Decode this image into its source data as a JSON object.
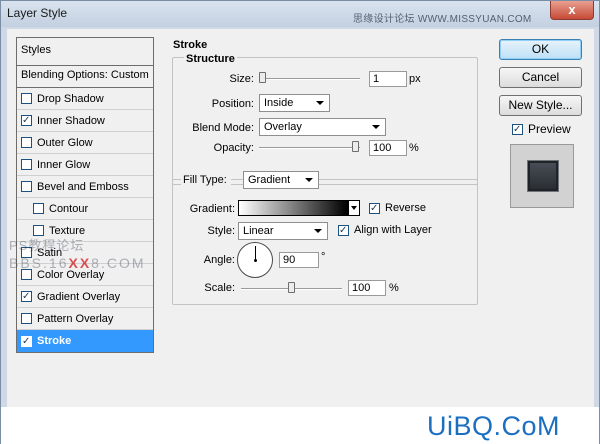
{
  "window": {
    "title": "Layer Style",
    "watermark_top": "思缘设计论坛 WWW.MISSYUAN.COM",
    "close_label": "x"
  },
  "sidebar": {
    "header": "Styles",
    "blending_options": "Blending Options: Custom",
    "items": [
      {
        "label": "Drop Shadow",
        "checked": false
      },
      {
        "label": "Inner Shadow",
        "checked": true
      },
      {
        "label": "Outer Glow",
        "checked": false
      },
      {
        "label": "Inner Glow",
        "checked": false
      },
      {
        "label": "Bevel and Emboss",
        "checked": false
      },
      {
        "label": "Contour",
        "checked": false
      },
      {
        "label": "Texture",
        "checked": false
      },
      {
        "label": "Satin",
        "checked": false
      },
      {
        "label": "Color Overlay",
        "checked": false
      },
      {
        "label": "Gradient Overlay",
        "checked": true
      },
      {
        "label": "Pattern Overlay",
        "checked": false
      },
      {
        "label": "Stroke",
        "checked": true,
        "selected": true
      }
    ],
    "watermark_line1": "PS教程论坛",
    "watermark_line2a": "BBS.16",
    "watermark_xx": "XX",
    "watermark_line2b": "8.COM"
  },
  "stroke": {
    "title": "Stroke",
    "structure_title": "Structure",
    "size_label": "Size:",
    "size_value": "1",
    "size_unit": "px",
    "size_level": 0.0,
    "position_label": "Position:",
    "position_value": "Inside",
    "blend_mode_label": "Blend Mode:",
    "blend_mode_value": "Overlay",
    "opacity_label": "Opacity:",
    "opacity_value": "100",
    "opacity_unit": "%",
    "opacity_level": 1.0
  },
  "fill": {
    "fill_type_label": "Fill Type:",
    "fill_type_value": "Gradient",
    "gradient_label": "Gradient:",
    "reverse_label": "Reverse",
    "reverse_checked": true,
    "style_label": "Style:",
    "style_value": "Linear",
    "align_label": "Align with Layer",
    "align_checked": true,
    "angle_label": "Angle:",
    "angle_value": "90",
    "angle_unit": "°",
    "scale_label": "Scale:",
    "scale_value": "100",
    "scale_unit": "%",
    "scale_level": 0.5
  },
  "buttons": {
    "ok": "OK",
    "cancel": "Cancel",
    "new_style": "New Style...",
    "preview": "Preview",
    "preview_checked": true
  },
  "footer": {
    "brand": "UiBQ.CoM"
  }
}
